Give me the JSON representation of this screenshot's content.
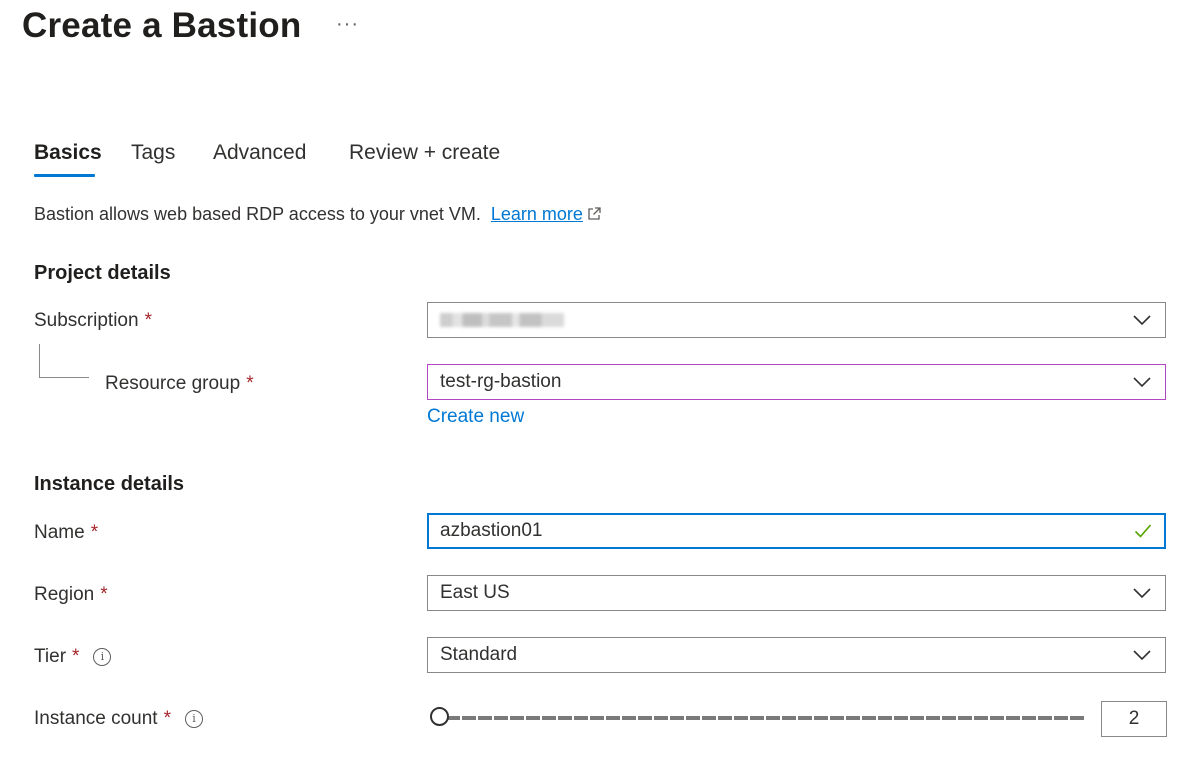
{
  "page": {
    "title": "Create a Bastion",
    "more_label": "···"
  },
  "tabs": [
    {
      "label": "Basics",
      "active": true
    },
    {
      "label": "Tags",
      "active": false
    },
    {
      "label": "Advanced",
      "active": false
    },
    {
      "label": "Review + create",
      "active": false
    }
  ],
  "description": {
    "text": "Bastion allows web based RDP access to your vnet VM.",
    "link": "Learn more",
    "link_icon": "external-link-icon"
  },
  "project_details": {
    "heading": "Project details",
    "subscription": {
      "label": "Subscription",
      "required": "*",
      "value": "(redacted)",
      "icon": "chevron-down-icon"
    },
    "resource_group": {
      "label": "Resource group",
      "required": "*",
      "value": "test-rg-bastion",
      "create_new": "Create new",
      "icon": "chevron-down-icon"
    }
  },
  "instance_details": {
    "heading": "Instance details",
    "name": {
      "label": "Name",
      "required": "*",
      "value": "azbastion01",
      "valid_icon": "checkmark-icon"
    },
    "region": {
      "label": "Region",
      "required": "*",
      "value": "East US",
      "icon": "chevron-down-icon"
    },
    "tier": {
      "label": "Tier",
      "required": "*",
      "info": "i",
      "value": "Standard",
      "icon": "chevron-down-icon"
    },
    "instance_count": {
      "label": "Instance count",
      "required": "*",
      "info": "i",
      "value": "2",
      "slider_fraction": 0.0
    }
  },
  "colors": {
    "accent": "#0078d4",
    "required": "#a4262c",
    "valid": "#57a300",
    "purple_border": "#b146c2"
  }
}
